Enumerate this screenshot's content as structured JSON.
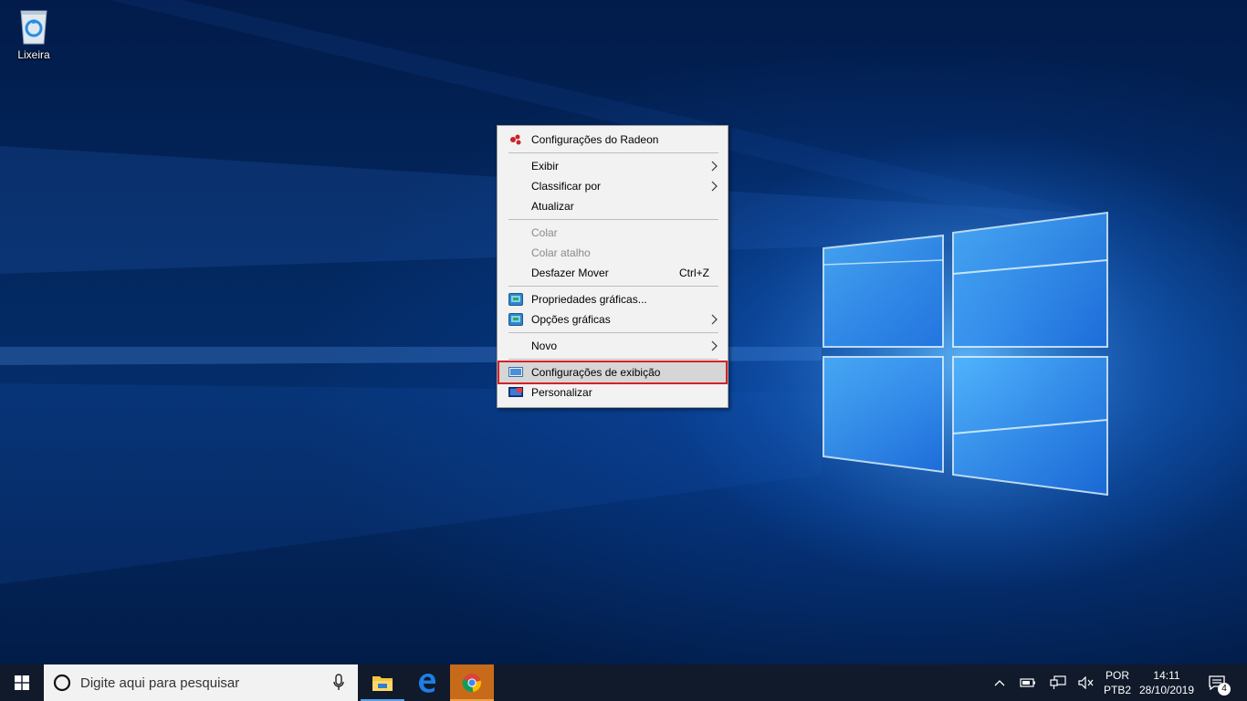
{
  "desktop": {
    "icons": [
      {
        "label": "Lixeira",
        "icon": "recycle-bin-icon"
      }
    ]
  },
  "context_menu": {
    "items": [
      {
        "label": "Configurações do Radeon",
        "icon": "radeon-icon",
        "enabled": true
      },
      {
        "label": "Exibir",
        "submenu": true,
        "enabled": true
      },
      {
        "label": "Classificar por",
        "submenu": true,
        "enabled": true
      },
      {
        "label": "Atualizar",
        "enabled": true
      },
      {
        "label": "Colar",
        "enabled": false
      },
      {
        "label": "Colar atalho",
        "enabled": false
      },
      {
        "label": "Desfazer Mover",
        "shortcut": "Ctrl+Z",
        "enabled": true
      },
      {
        "label": "Propriedades gráficas...",
        "icon": "intel-graphics-icon",
        "enabled": true
      },
      {
        "label": "Opções gráficas",
        "icon": "intel-graphics-icon",
        "submenu": true,
        "enabled": true
      },
      {
        "label": "Novo",
        "submenu": true,
        "enabled": true
      },
      {
        "label": "Configurações de exibição",
        "icon": "display-settings-icon",
        "enabled": true,
        "selected": true
      },
      {
        "label": "Personalizar",
        "icon": "personalize-icon",
        "enabled": true
      }
    ]
  },
  "taskbar": {
    "search_placeholder": "Digite aqui para pesquisar",
    "pinned_apps": [
      "file-explorer-icon",
      "edge-icon",
      "chrome-icon"
    ],
    "active_app": "chrome-icon",
    "tray": {
      "language_line1": "POR",
      "language_line2": "PTB2",
      "time": "14:11",
      "date": "28/10/2019",
      "notification_count": "4"
    }
  },
  "colors": {
    "menu_bg": "#f2f2f2",
    "highlight_outline": "#d3222a",
    "taskbar_bg": "#101a2a",
    "active_app_bg": "#c76b1a"
  }
}
